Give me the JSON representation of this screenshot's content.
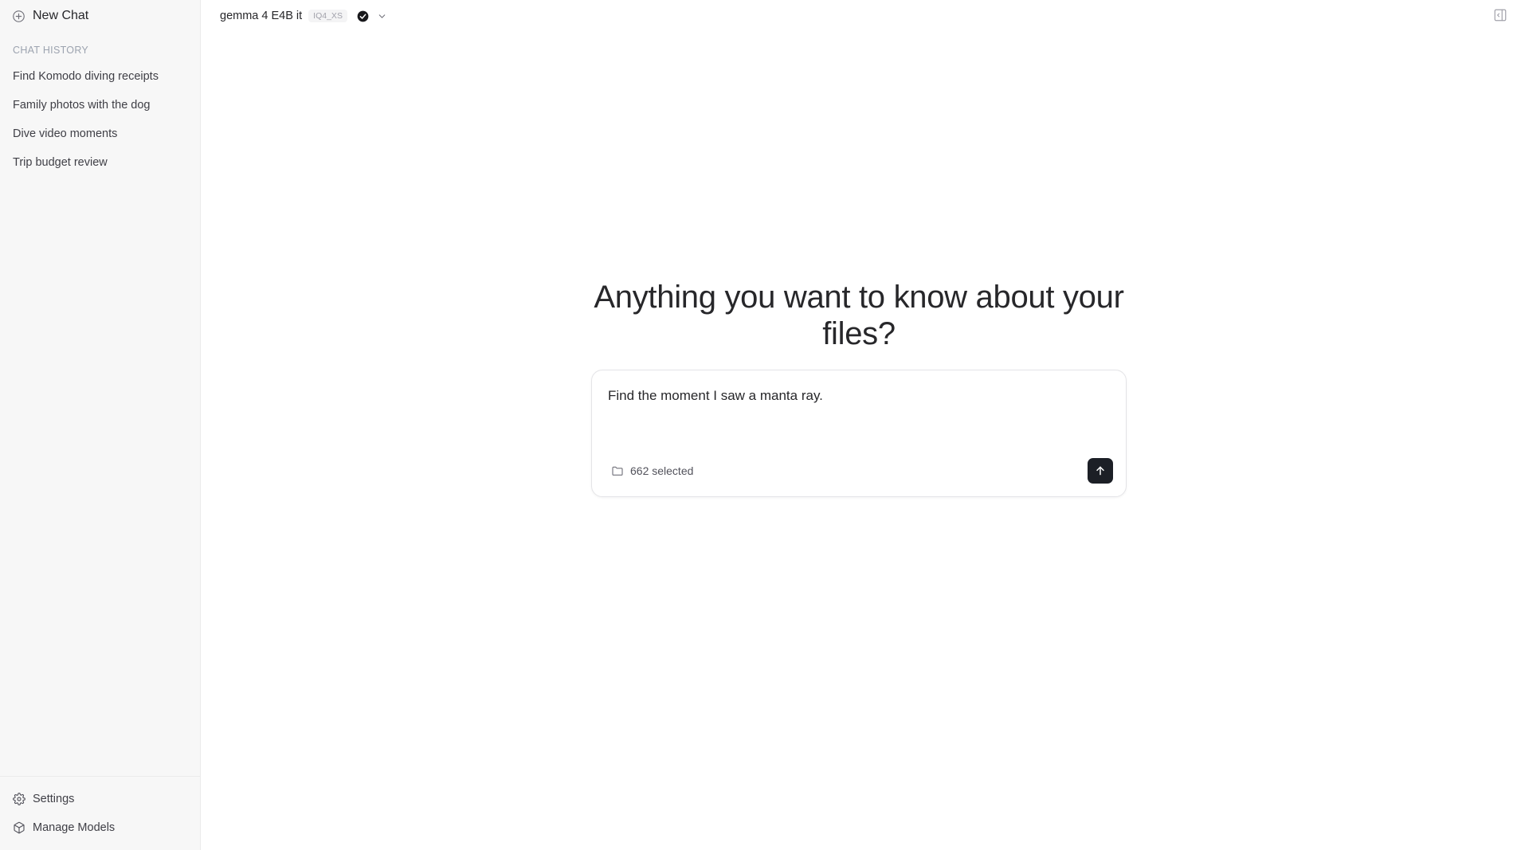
{
  "sidebar": {
    "new_chat_label": "New Chat",
    "history_label": "CHAT HISTORY",
    "history": [
      {
        "label": "Find Komodo diving receipts"
      },
      {
        "label": "Family photos with the dog"
      },
      {
        "label": "Dive video moments"
      },
      {
        "label": "Trip budget review"
      }
    ],
    "footer": {
      "settings_label": "Settings",
      "manage_models_label": "Manage Models"
    }
  },
  "topbar": {
    "model_name": "gemma 4 E4B it",
    "model_quant": "IQ4_XS",
    "model_status_icon": "check-circle-icon",
    "dropdown_icon": "chevron-down-icon",
    "panel_toggle_icon": "panel-toggle-icon"
  },
  "main": {
    "hero_title": "Anything you want to know about your files?",
    "composer": {
      "input_value": "Find the moment I saw a manta ray.",
      "files_selected": "662 selected",
      "send_icon": "arrow-up-icon"
    }
  },
  "colors": {
    "sidebar_bg": "#f7f7f7",
    "send_button_bg": "#1c1f26",
    "muted_text": "#9ca3af"
  }
}
